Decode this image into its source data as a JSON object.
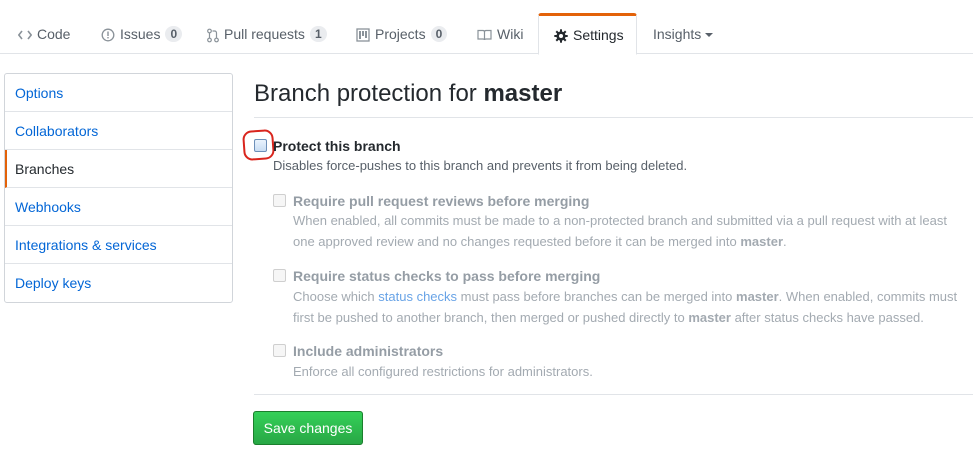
{
  "tabs": [
    {
      "label": "Code",
      "icon": "code-icon"
    },
    {
      "label": "Issues",
      "icon": "issue-icon",
      "count": "0"
    },
    {
      "label": "Pull requests",
      "icon": "pull-request-icon",
      "count": "1"
    },
    {
      "label": "Projects",
      "icon": "project-icon",
      "count": "0"
    },
    {
      "label": "Wiki",
      "icon": "book-icon"
    },
    {
      "label": "Settings",
      "icon": "gear-icon",
      "selected": true
    },
    {
      "label": "Insights",
      "icon": "caret-down-icon"
    }
  ],
  "menu": [
    {
      "label": "Options"
    },
    {
      "label": "Collaborators"
    },
    {
      "label": "Branches",
      "selected": true
    },
    {
      "label": "Webhooks"
    },
    {
      "label": "Integrations & services"
    },
    {
      "label": "Deploy keys"
    }
  ],
  "page": {
    "title_prefix": "Branch protection for",
    "branch": "master"
  },
  "protect": {
    "label": "Protect this branch",
    "note": "Disables force-pushes to this branch and prevents it from being deleted.",
    "checked": false
  },
  "options": {
    "reviews": {
      "label": "Require pull request reviews before merging",
      "note_1": "When enabled, all commits must be made to a non-protected branch and submitted via a pull request with at least",
      "note_2": "one approved review and no changes requested before it can be merged into",
      "note_branch": "master",
      "note_end": "."
    },
    "status": {
      "label": "Require status checks to pass before merging",
      "note_a": "Choose which",
      "note_link": "status checks",
      "note_b": "must pass before branches can be merged into",
      "note_branch": "master",
      "note_c": ". When enabled, commits must",
      "note_d": "first be pushed to another branch, then merged or pushed directly to",
      "note_branch2": "master",
      "note_e": "after status checks have passed."
    },
    "admins": {
      "label": "Include administrators",
      "note": "Enforce all configured restrictions for administrators."
    }
  },
  "save_label": "Save changes",
  "colors": {
    "accent_tab": "#e36209",
    "link": "#0366d6",
    "save_green": "#28a745",
    "annotation_red": "#d9251d"
  }
}
